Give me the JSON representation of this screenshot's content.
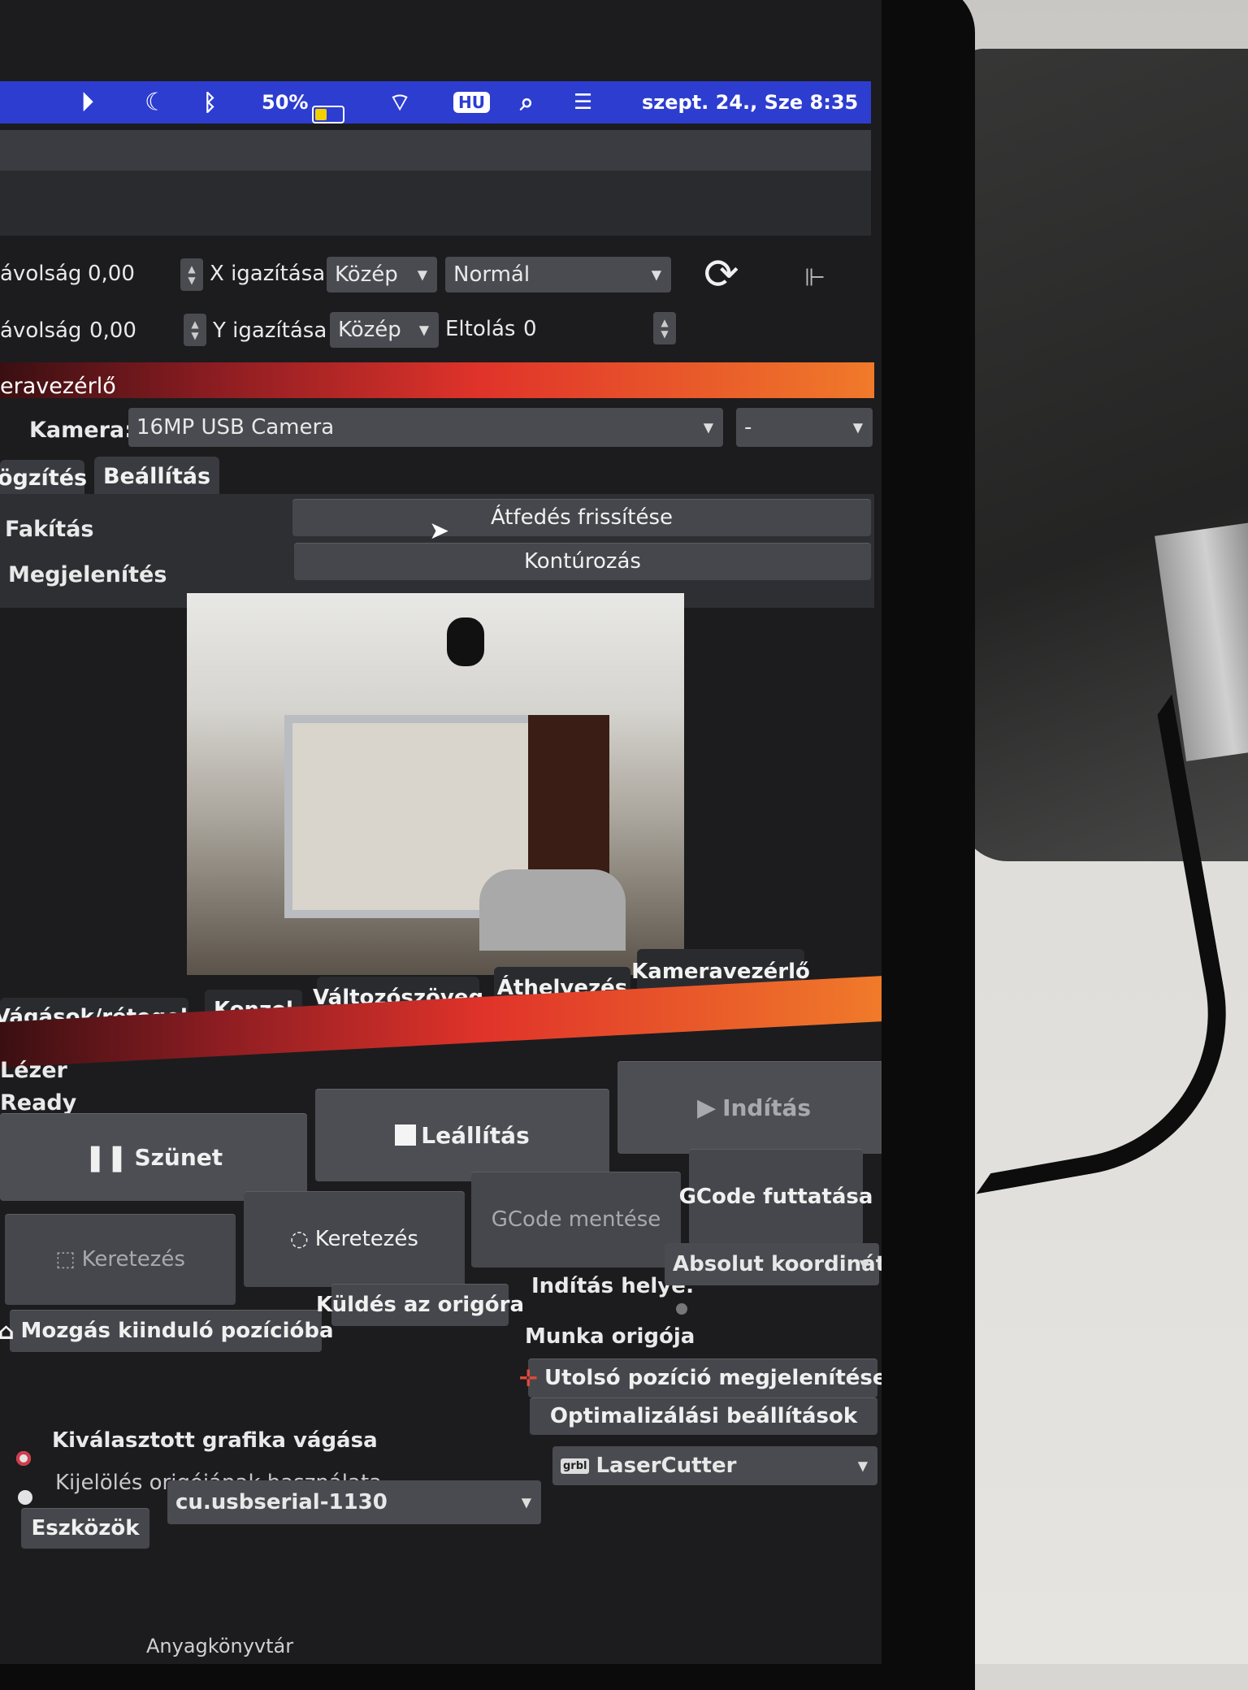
{
  "menubar": {
    "battery_percent": "50%",
    "input_source": "HU",
    "datetime": "szept. 24., Sze 8:35"
  },
  "params": {
    "row1_label": "ávolság",
    "row1_value": "0,00",
    "row2_label": "ávolság",
    "row2_value": "0,00",
    "x_align_label": "X igazítása",
    "x_align_value": "Közép",
    "y_align_label": "Y igazítása",
    "y_align_value": "Közép",
    "mode_value": "Normál",
    "offset_label": "Eltolás",
    "offset_value": "0"
  },
  "camera_panel": {
    "title": "eravezérlő",
    "camera_label": "Kamera:",
    "camera_value": "16MP USB Camera",
    "second_value": "-",
    "tabs": [
      "ögzítés",
      "Beállítás"
    ],
    "rows": [
      "Fakítás",
      "Megjelenítés"
    ],
    "buttons": [
      "Átfedés frissítése",
      "Kontúrozás"
    ]
  },
  "bottom_tabs": [
    "Vágások/rétegek",
    "Konzol",
    "Változószöveg",
    "Áthelyezés",
    "Kameravezérlő"
  ],
  "laser_panel": {
    "title": "Lézer",
    "status": "Ready",
    "pause": "Szünet",
    "stop": "Leállítás",
    "start": "Indítás",
    "frame1": "Keretezés",
    "frame2": "Keretezés",
    "save_gcode": "GCode mentése",
    "run_gcode": "GCode futtatása",
    "home": "Mozgás kiinduló pozícióba",
    "send_origin": "Küldés az origóra",
    "start_from_label": "Indítás helye:",
    "start_from_value": "Absolut koordináták",
    "work_origin": "Munka origója",
    "show_last": "Utolsó pozíció megjelenítése",
    "optimize": "Optimalizálási beállítások",
    "cut_selected": "Kiválasztott grafika vágása",
    "use_selection_origin": "Kijelölés origójának használata",
    "tools": "Eszközök",
    "port": "cu.usbserial-1130",
    "device": "LaserCutter",
    "device_badge": "grbl"
  },
  "library": {
    "title": "Anyagkönyvtár"
  }
}
